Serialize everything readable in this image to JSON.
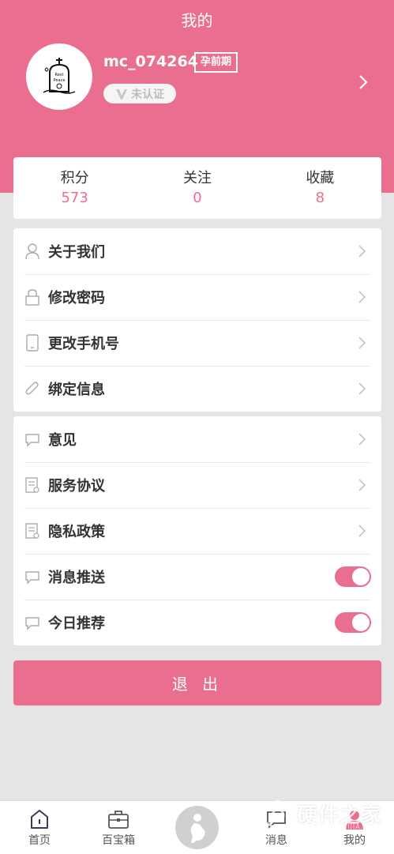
{
  "header": {
    "title": "我的",
    "username": "mc_074264",
    "stage_badge": "孕前期",
    "verify_status": "未认证"
  },
  "stats": [
    {
      "label": "积分",
      "value": "573"
    },
    {
      "label": "关注",
      "value": "0"
    },
    {
      "label": "收藏",
      "value": "8"
    }
  ],
  "menu_group_1": [
    {
      "label": "关于我们",
      "icon": "user-icon"
    },
    {
      "label": "修改密码",
      "icon": "lock-icon"
    },
    {
      "label": "更改手机号",
      "icon": "phone-icon"
    },
    {
      "label": "绑定信息",
      "icon": "paperclip-icon"
    }
  ],
  "menu_group_2": [
    {
      "label": "意见",
      "icon": "chat-icon"
    },
    {
      "label": "服务协议",
      "icon": "document-icon"
    },
    {
      "label": "隐私政策",
      "icon": "document-icon"
    },
    {
      "label": "消息推送",
      "icon": "chat-icon",
      "toggle": true
    },
    {
      "label": "今日推荐",
      "icon": "chat-icon",
      "toggle": true
    }
  ],
  "logout_label": "退 出",
  "tabs": [
    {
      "label": "首页",
      "icon": "home-icon"
    },
    {
      "label": "百宝箱",
      "icon": "toolbox-icon"
    },
    {
      "label": "",
      "icon": "pregnancy-icon"
    },
    {
      "label": "消息",
      "icon": "message-icon"
    },
    {
      "label": "我的",
      "icon": "person-icon",
      "active": true
    }
  ],
  "watermark": {
    "title": "硬件之家",
    "subtitle": "YING JIAN ZHIJIA.com"
  },
  "colors": {
    "accent": "#ea6f8f",
    "background": "#e5e5e5"
  }
}
